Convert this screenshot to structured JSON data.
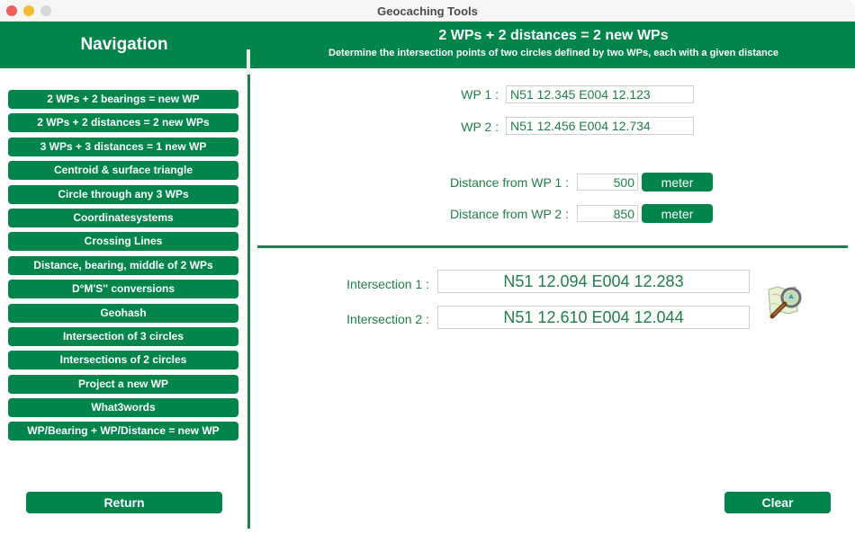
{
  "window": {
    "title": "Geocaching Tools"
  },
  "header": {
    "nav_title": "Navigation",
    "main_title": "2 WPs + 2 distances = 2 new WPs",
    "main_subtitle": "Determine the intersection points of two circles defined by two WPs, each with a given distance"
  },
  "sidebar": {
    "items": [
      {
        "label": "2 WPs + 2 bearings = new WP"
      },
      {
        "label": "2 WPs + 2 distances = 2 new WPs"
      },
      {
        "label": "3 WPs + 3 distances = 1 new WP"
      },
      {
        "label": "Centroid & surface triangle"
      },
      {
        "label": "Circle through any 3 WPs"
      },
      {
        "label": "Coordinatesystems"
      },
      {
        "label": "Crossing Lines"
      },
      {
        "label": "Distance, bearing, middle of 2 WPs"
      },
      {
        "label": "D°M'S'' conversions"
      },
      {
        "label": "Geohash"
      },
      {
        "label": "Intersection of 3 circles"
      },
      {
        "label": "Intersections of 2 circles"
      },
      {
        "label": "Project a new WP"
      },
      {
        "label": "What3words"
      },
      {
        "label": "WP/Bearing + WP/Distance = new WP"
      }
    ],
    "return_label": "Return"
  },
  "form": {
    "wp1_label": "WP 1 :",
    "wp1_value": "N51 12.345  E004 12.123",
    "wp2_label": "WP 2 :",
    "wp2_value": "N51 12.456  E004 12.734",
    "dist1_label": "Distance from WP 1 :",
    "dist1_value": "500",
    "dist1_unit": "meter",
    "dist2_label": "Distance from WP 2 :",
    "dist2_value": "850",
    "dist2_unit": "meter"
  },
  "results": {
    "int1_label": "Intersection 1 :",
    "int1_value": "N51 12.094  E004 12.283",
    "int2_label": "Intersection 2 :",
    "int2_value": "N51 12.610  E004 12.044",
    "map_icon": "map-magnifier-icon"
  },
  "footer": {
    "clear_label": "Clear"
  },
  "colors": {
    "accent": "#02854b",
    "text_green": "#1f7e4b"
  }
}
